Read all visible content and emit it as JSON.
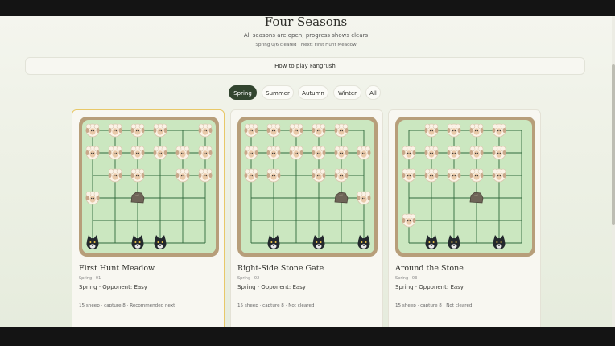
{
  "page": {
    "title": "Four Seasons",
    "subtitle": "All seasons are open; progress shows clears",
    "progress": "Spring 0/6 cleared · Next: First Hunt Meadow",
    "howto_label": "How to play Fangrush"
  },
  "tabs": [
    {
      "label": "Spring",
      "active": true
    },
    {
      "label": "Summer",
      "active": false
    },
    {
      "label": "Autumn",
      "active": false
    },
    {
      "label": "Winter",
      "active": false
    },
    {
      "label": "All",
      "active": false
    }
  ],
  "levels": [
    {
      "name": "First Hunt Meadow",
      "code": "Spring · 01",
      "meta": "Spring · Opponent:  Easy",
      "footer": "15 sheep · capture 8 · Recommended next",
      "board": {
        "sheep": [
          [
            0,
            0
          ],
          [
            1,
            0
          ],
          [
            2,
            0
          ],
          [
            3,
            0
          ],
          [
            5,
            0
          ],
          [
            0,
            1
          ],
          [
            1,
            1
          ],
          [
            2,
            1
          ],
          [
            3,
            1
          ],
          [
            4,
            1
          ],
          [
            5,
            1
          ],
          [
            1,
            2
          ],
          [
            2,
            2
          ],
          [
            4,
            2
          ],
          [
            5,
            2
          ],
          [
            0,
            3
          ]
        ],
        "stones": [
          [
            2,
            3
          ]
        ],
        "wolves": [
          [
            0,
            5
          ],
          [
            2,
            5
          ],
          [
            3,
            5
          ]
        ]
      }
    },
    {
      "name": "Right-Side Stone Gate",
      "code": "Spring · 02",
      "meta": "Spring · Opponent:  Easy",
      "footer": "15 sheep · capture 8 · Not cleared",
      "board": {
        "sheep": [
          [
            0,
            0
          ],
          [
            1,
            0
          ],
          [
            2,
            0
          ],
          [
            3,
            0
          ],
          [
            4,
            0
          ],
          [
            0,
            1
          ],
          [
            1,
            1
          ],
          [
            2,
            1
          ],
          [
            3,
            1
          ],
          [
            4,
            1
          ],
          [
            5,
            1
          ],
          [
            0,
            2
          ],
          [
            1,
            2
          ],
          [
            3,
            2
          ],
          [
            4,
            2
          ],
          [
            5,
            3
          ]
        ],
        "stones": [
          [
            4,
            3
          ]
        ],
        "wolves": [
          [
            1,
            5
          ],
          [
            3,
            5
          ],
          [
            5,
            5
          ]
        ]
      }
    },
    {
      "name": "Around the Stone",
      "code": "Spring · 03",
      "meta": "Spring · Opponent:  Easy",
      "footer": "15 sheep · capture 8 · Not cleared",
      "board": {
        "sheep": [
          [
            1,
            0
          ],
          [
            2,
            0
          ],
          [
            3,
            0
          ],
          [
            4,
            0
          ],
          [
            0,
            1
          ],
          [
            1,
            1
          ],
          [
            2,
            1
          ],
          [
            3,
            1
          ],
          [
            4,
            1
          ],
          [
            0,
            2
          ],
          [
            1,
            2
          ],
          [
            2,
            2
          ],
          [
            3,
            2
          ],
          [
            4,
            2
          ],
          [
            0,
            4
          ]
        ],
        "stones": [
          [
            3,
            3
          ]
        ],
        "wolves": [
          [
            1,
            5
          ],
          [
            2,
            5
          ],
          [
            4,
            5
          ]
        ]
      }
    }
  ],
  "colors": {
    "board_fill": "#cbe7c0",
    "board_frame": "#b79e7a",
    "grid_line": "#2f6a3c",
    "tab_active": "#32452f",
    "selected_border": "#e8c868"
  }
}
